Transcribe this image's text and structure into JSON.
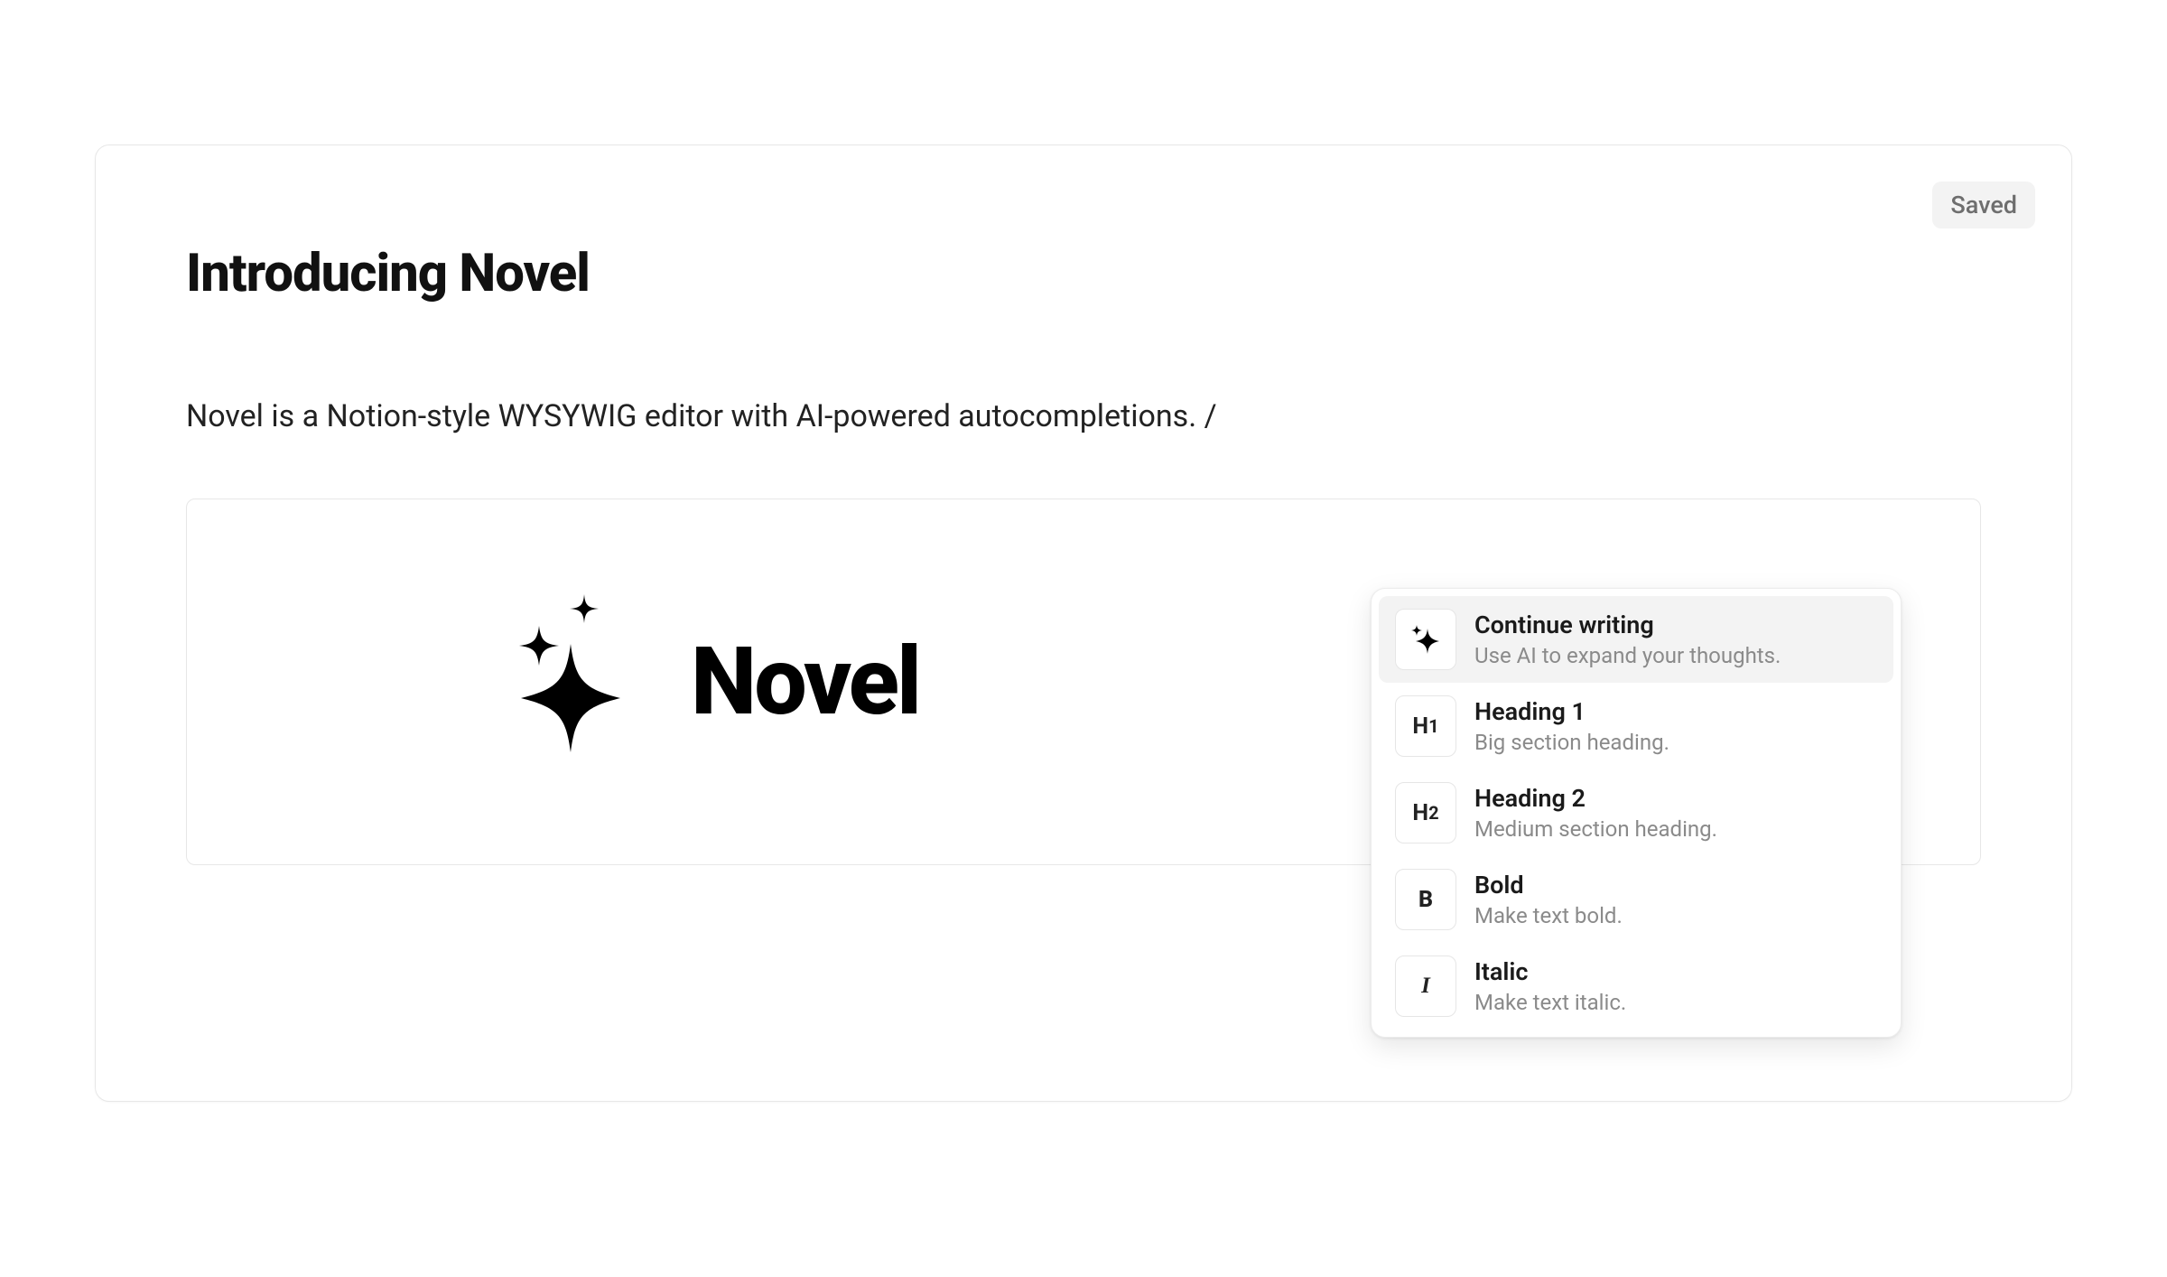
{
  "status": {
    "saved_label": "Saved"
  },
  "document": {
    "title": "Introducing Novel",
    "paragraph": "Novel is a Notion-style WYSYWIG editor with AI-powered autocompletions. /",
    "logo_word": "Novel"
  },
  "slash_menu": {
    "items": [
      {
        "icon": "sparkles",
        "title": "Continue writing",
        "subtitle": "Use AI to expand your thoughts.",
        "selected": true
      },
      {
        "icon": "H1",
        "title": "Heading 1",
        "subtitle": "Big section heading.",
        "selected": false
      },
      {
        "icon": "H2",
        "title": "Heading 2",
        "subtitle": "Medium section heading.",
        "selected": false
      },
      {
        "icon": "B",
        "title": "Bold",
        "subtitle": "Make text bold.",
        "selected": false
      },
      {
        "icon": "I",
        "title": "Italic",
        "subtitle": "Make text italic.",
        "selected": false
      }
    ]
  }
}
